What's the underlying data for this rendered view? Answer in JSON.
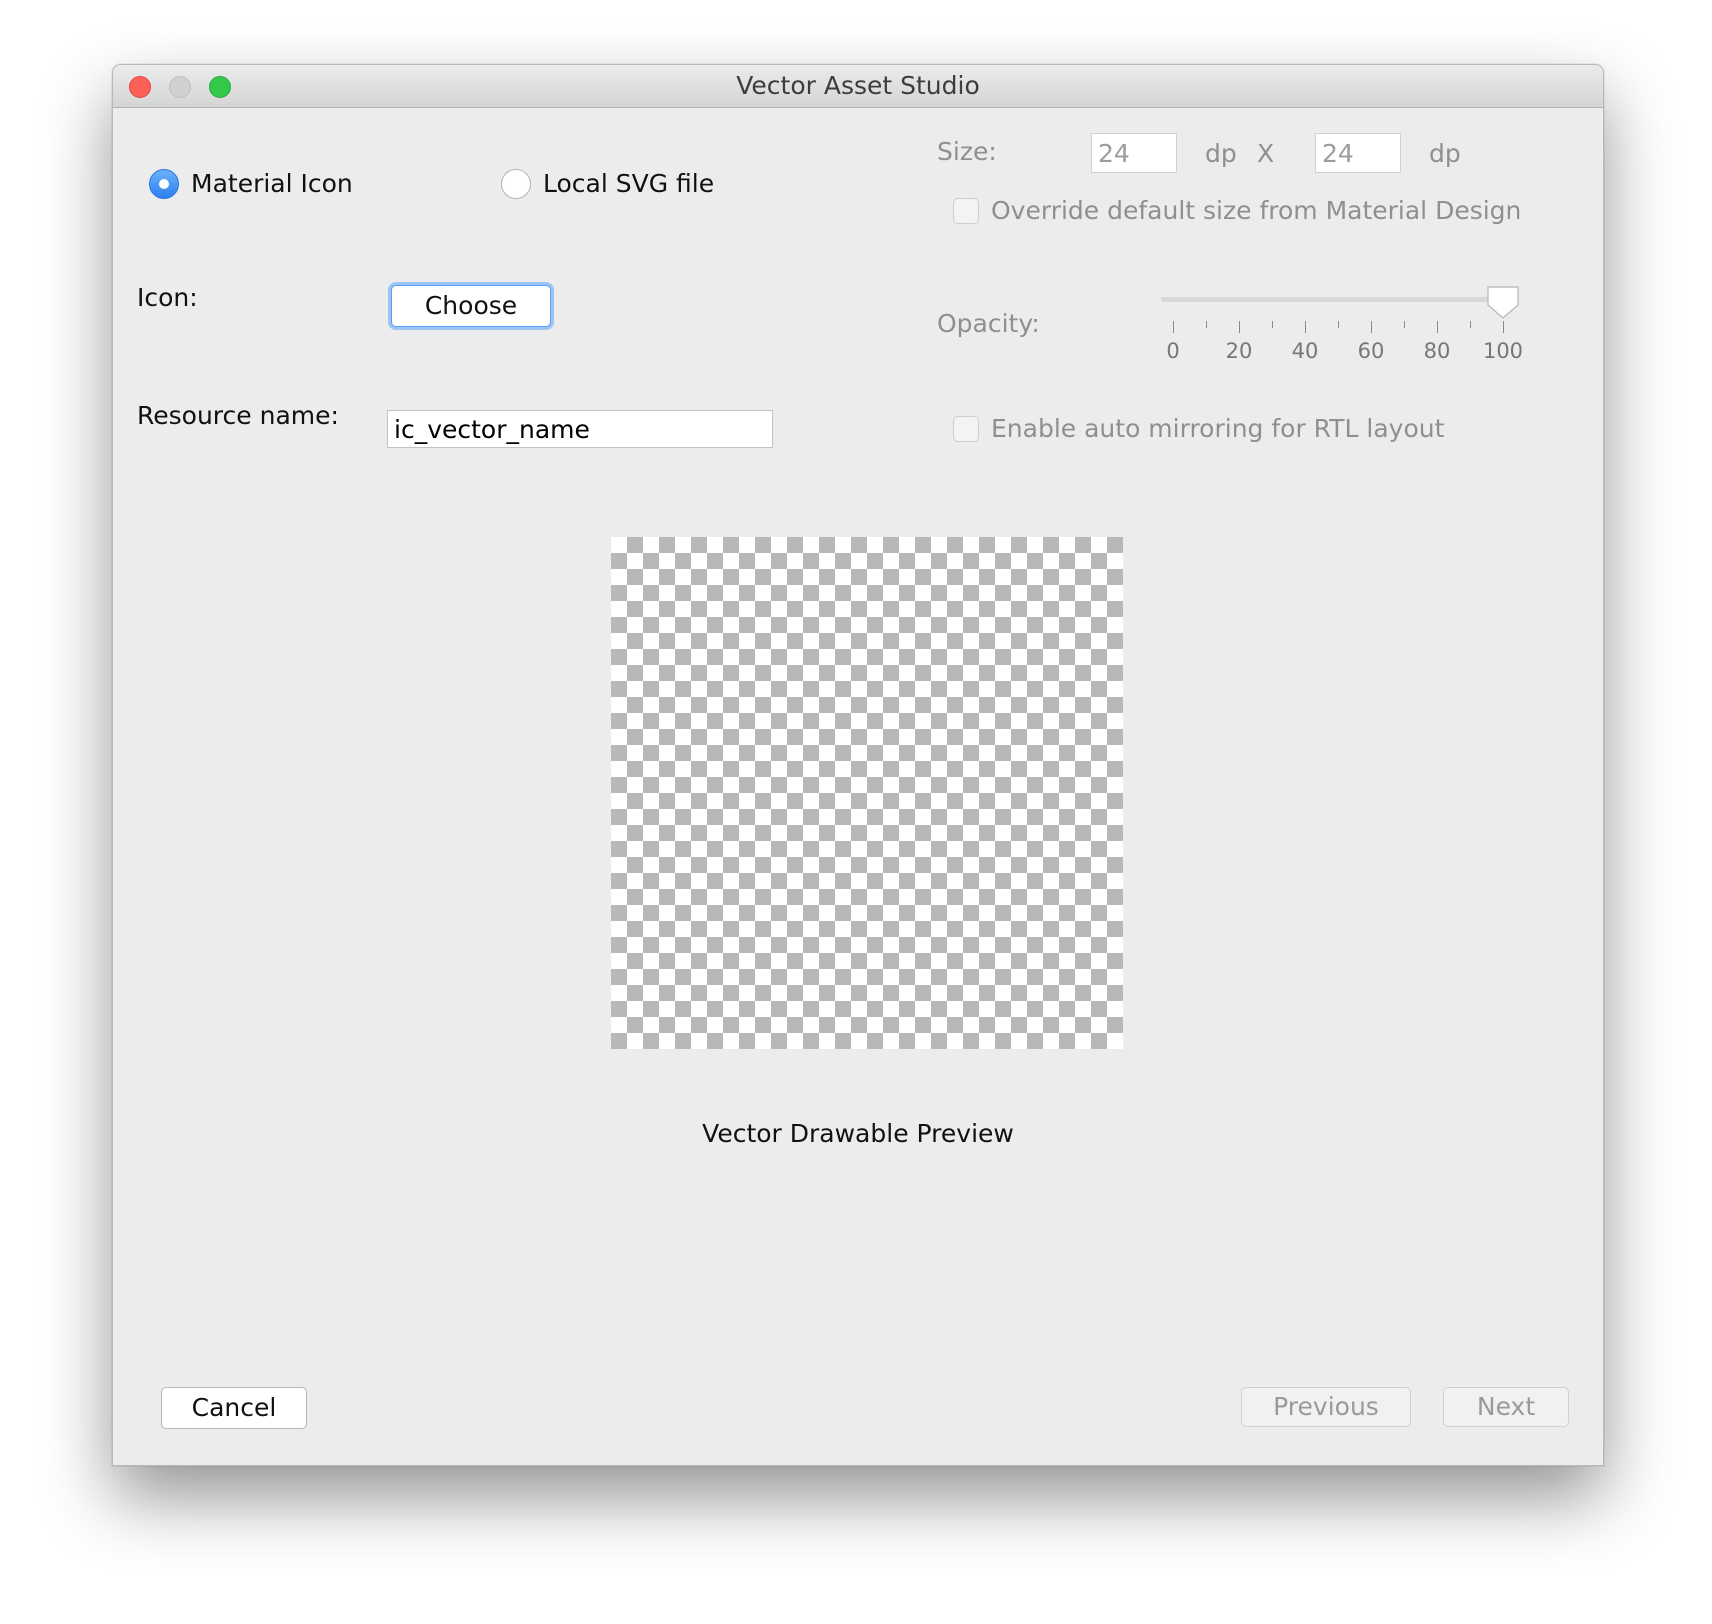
{
  "window": {
    "title": "Vector Asset Studio"
  },
  "source_type": {
    "options": [
      {
        "label": "Material Icon",
        "selected": true
      },
      {
        "label": "Local SVG file",
        "selected": false
      }
    ]
  },
  "icon": {
    "label": "Icon:",
    "button_label": "Choose"
  },
  "resource_name": {
    "label": "Resource name:",
    "value": "ic_vector_name"
  },
  "size": {
    "label": "Size:",
    "width": "24",
    "width_unit": "dp",
    "separator": "X",
    "height": "24",
    "height_unit": "dp",
    "override_label": "Override default size from Material Design",
    "override_checked": false
  },
  "opacity": {
    "label": "Opacity:",
    "value": 100,
    "min": 0,
    "max": 100,
    "tick_labels": [
      "0",
      "20",
      "40",
      "60",
      "80",
      "100"
    ]
  },
  "auto_mirror": {
    "label": "Enable auto mirroring for RTL layout",
    "checked": false
  },
  "preview": {
    "caption": "Vector Drawable Preview"
  },
  "footer": {
    "cancel_label": "Cancel",
    "previous_label": "Previous",
    "next_label": "Next"
  },
  "colors": {
    "accent": "#2b7ff1",
    "close": "#fc5f57",
    "maximize": "#34c84a",
    "checker_dark": "#b8b8b8",
    "checker_light": "#ffffff"
  }
}
